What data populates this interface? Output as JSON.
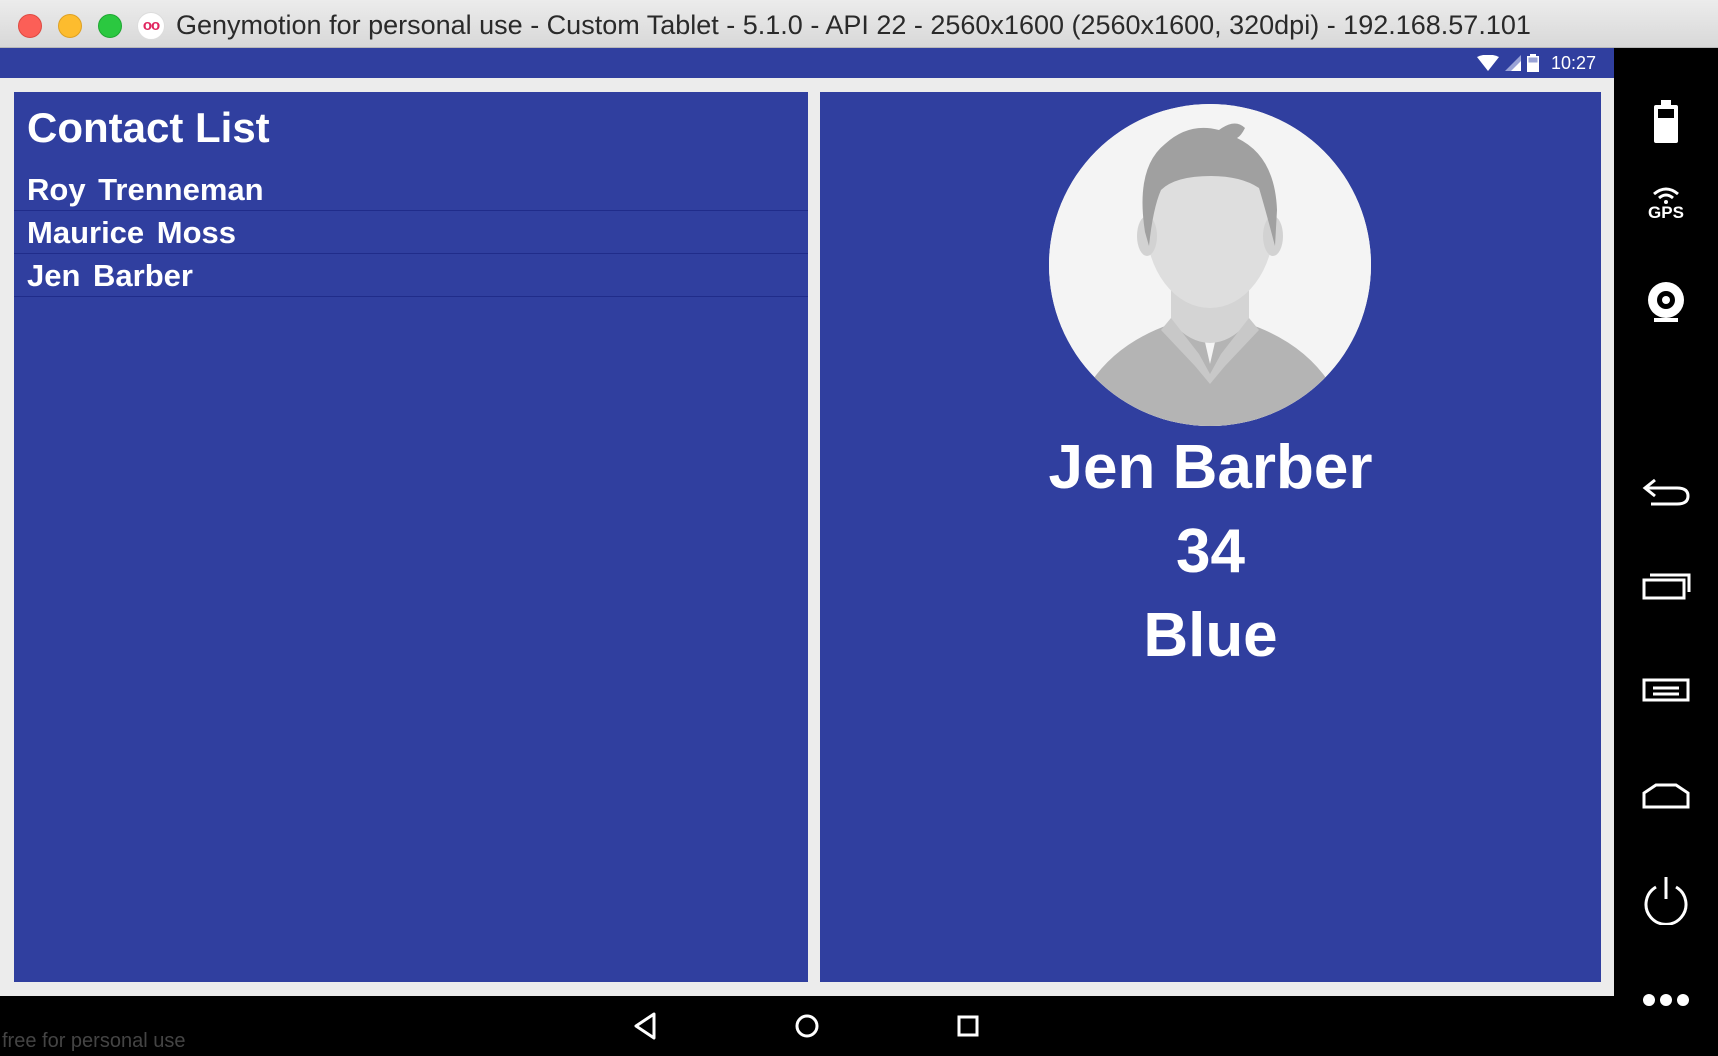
{
  "window": {
    "title": "Genymotion for personal use - Custom Tablet - 5.1.0 - API 22 - 2560x1600 (2560x1600, 320dpi) - 192.168.57.101",
    "logo_text": "oo"
  },
  "statusbar": {
    "time": "10:27",
    "icons": [
      "wifi-icon",
      "signal-icon",
      "battery-icon"
    ]
  },
  "contact_list": {
    "title": "Contact List",
    "items": [
      {
        "label": "Roy Trenneman"
      },
      {
        "label": "Maurice Moss"
      },
      {
        "label": "Jen Barber"
      }
    ]
  },
  "detail": {
    "name": "Jen Barber",
    "age": "34",
    "favorite_color": "Blue",
    "avatar": "person-silhouette-icon"
  },
  "navbar": {
    "buttons": [
      "back-triangle-icon",
      "home-circle-icon",
      "recents-square-icon"
    ]
  },
  "sidebar": {
    "gps_label": "GPS",
    "buttons": [
      "battery-icon",
      "gps-icon",
      "camera-icon",
      "back-icon",
      "recent-apps-icon",
      "menu-icon",
      "home-icon",
      "power-icon",
      "more-icon"
    ]
  },
  "watermark": "free for personal use",
  "colors": {
    "primary": "#303f9f",
    "screen_bg": "#ececec",
    "text": "#ffffff"
  }
}
